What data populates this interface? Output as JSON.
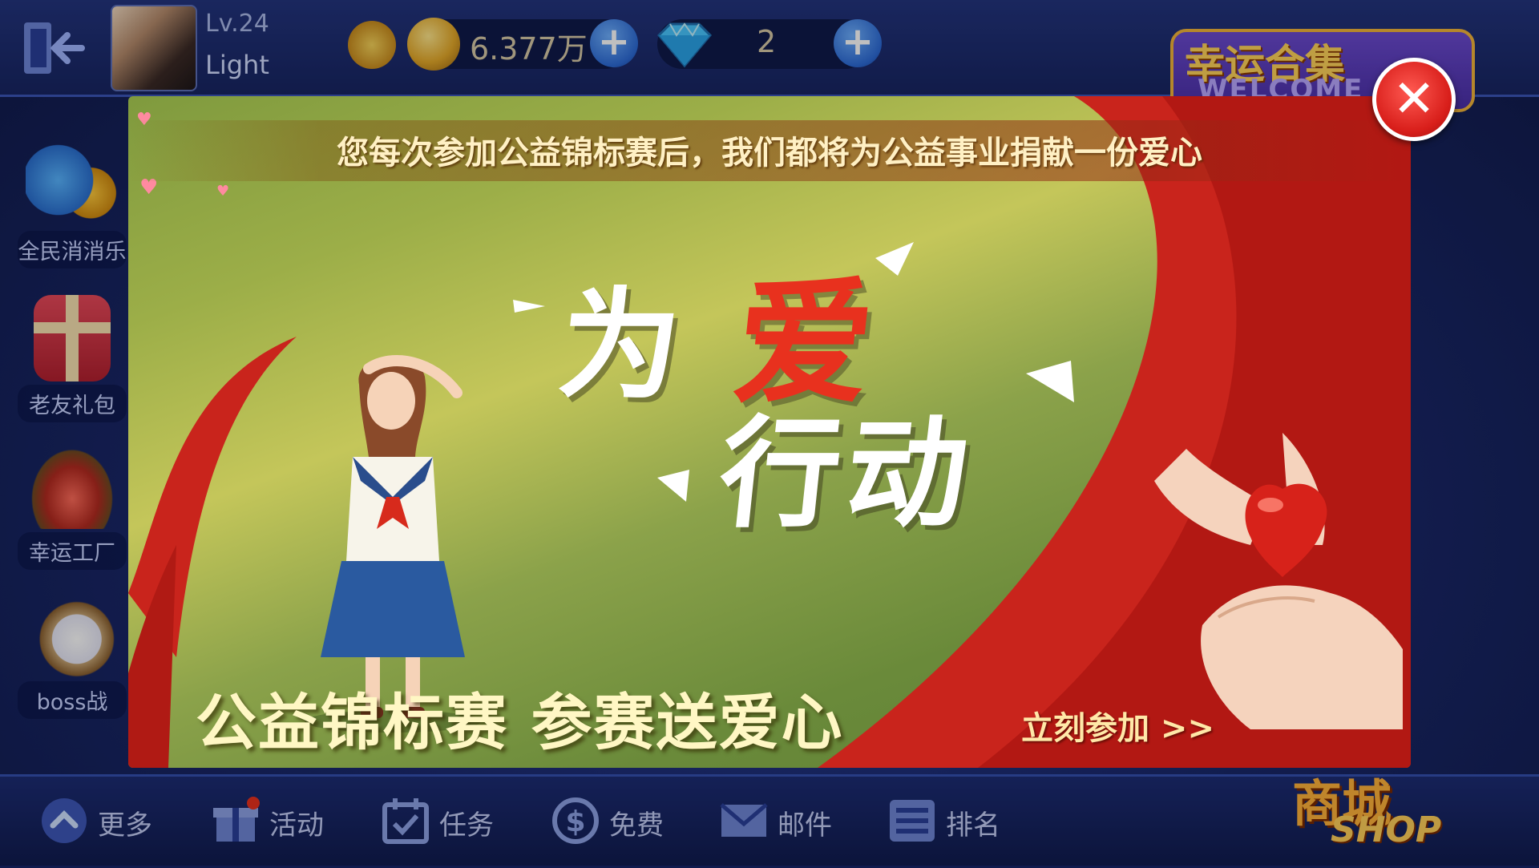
{
  "header": {
    "level": "Lv.24",
    "nickname": "Light",
    "coins": "6.377万",
    "diamonds": "2",
    "welcome_title": "幸运合集",
    "welcome_sub": "WELCOME"
  },
  "side_menu": [
    {
      "label": "全民消消乐",
      "icon": "match-game-icon"
    },
    {
      "label": "老友礼包",
      "icon": "gift-box-icon"
    },
    {
      "label": "幸运工厂",
      "icon": "lucky-cake-icon"
    },
    {
      "label": "boss战",
      "icon": "boss-creature-icon"
    }
  ],
  "bottom_menu": [
    {
      "label": "更多",
      "icon": "chevron-up-icon"
    },
    {
      "label": "活动",
      "icon": "gift-icon"
    },
    {
      "label": "任务",
      "icon": "task-calendar-icon"
    },
    {
      "label": "免费",
      "icon": "dollar-icon"
    },
    {
      "label": "邮件",
      "icon": "mail-icon"
    },
    {
      "label": "排名",
      "icon": "list-icon"
    }
  ],
  "shop": {
    "title": "商城",
    "sub": "SHOP"
  },
  "banner": {
    "notice": "您每次参加公益锦标赛后，我们都将为公益事业捐献一份爱心",
    "title_part1": "为",
    "title_part2": "爱",
    "title_line2": "行动",
    "subtitle": "公益锦标赛  参赛送爱心",
    "join_label": "立刻参加 >>"
  },
  "colors": {
    "accent_red": "#e8311e",
    "banner_green": "#8ba24a",
    "ui_blue": "#1b2a70",
    "gold": "#ffd35a"
  }
}
